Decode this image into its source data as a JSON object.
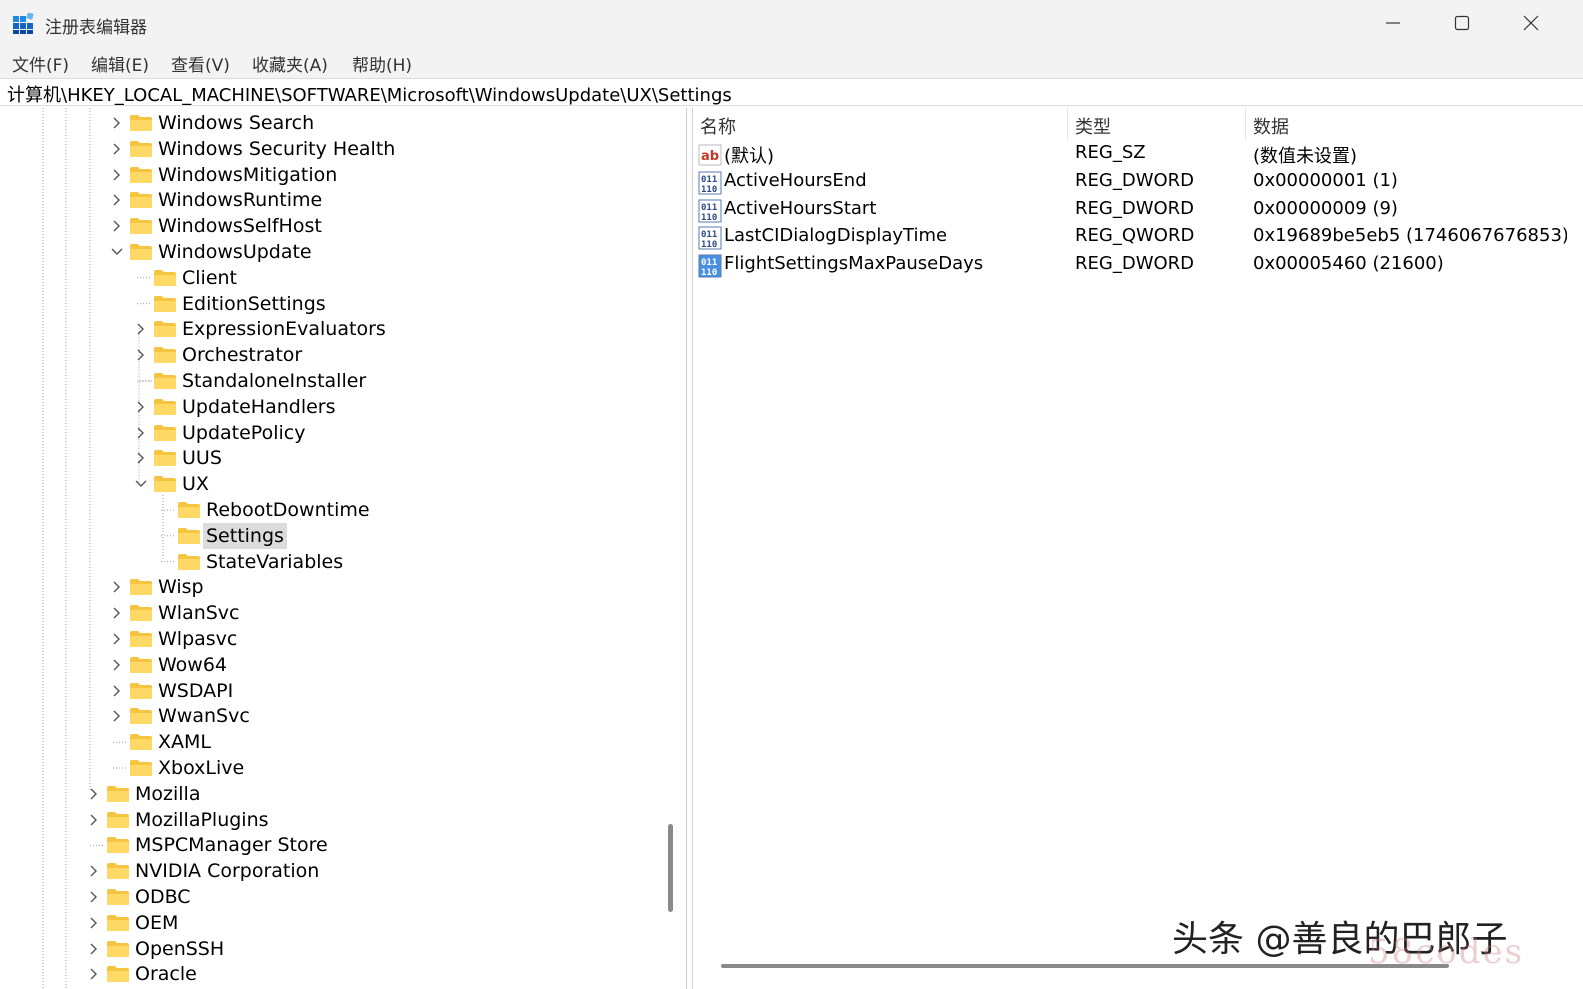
{
  "window": {
    "title": "注册表编辑器",
    "controls": {
      "minimize": "minimize",
      "maximize": "maximize",
      "close": "close"
    }
  },
  "menu": [
    "文件(F)",
    "编辑(E)",
    "查看(V)",
    "收藏夹(A)",
    "帮助(H)"
  ],
  "address": "计算机\\HKEY_LOCAL_MACHINE\\SOFTWARE\\Microsoft\\WindowsUpdate\\UX\\Settings",
  "tree": [
    {
      "label": "Windows Search",
      "expander": "collapsed",
      "level": 2
    },
    {
      "label": "Windows Security Health",
      "expander": "collapsed",
      "level": 2
    },
    {
      "label": "WindowsMitigation",
      "expander": "collapsed",
      "level": 2
    },
    {
      "label": "WindowsRuntime",
      "expander": "collapsed",
      "level": 2
    },
    {
      "label": "WindowsSelfHost",
      "expander": "collapsed",
      "level": 2
    },
    {
      "label": "WindowsUpdate",
      "expander": "expanded",
      "level": 2
    },
    {
      "label": "Client",
      "expander": "none",
      "level": 3
    },
    {
      "label": "EditionSettings",
      "expander": "none",
      "level": 3
    },
    {
      "label": "ExpressionEvaluators",
      "expander": "collapsed",
      "level": 3
    },
    {
      "label": "Orchestrator",
      "expander": "collapsed",
      "level": 3
    },
    {
      "label": "StandaloneInstaller",
      "expander": "none",
      "level": 3
    },
    {
      "label": "UpdateHandlers",
      "expander": "collapsed",
      "level": 3
    },
    {
      "label": "UpdatePolicy",
      "expander": "collapsed",
      "level": 3
    },
    {
      "label": "UUS",
      "expander": "collapsed",
      "level": 3
    },
    {
      "label": "UX",
      "expander": "expanded",
      "level": 3
    },
    {
      "label": "RebootDowntime",
      "expander": "none",
      "level": 4
    },
    {
      "label": "Settings",
      "expander": "none",
      "level": 4,
      "selected": true
    },
    {
      "label": "StateVariables",
      "expander": "none",
      "level": 4
    },
    {
      "label": "Wisp",
      "expander": "collapsed",
      "level": 2
    },
    {
      "label": "WlanSvc",
      "expander": "collapsed",
      "level": 2
    },
    {
      "label": "Wlpasvc",
      "expander": "collapsed",
      "level": 2
    },
    {
      "label": "Wow64",
      "expander": "collapsed",
      "level": 2
    },
    {
      "label": "WSDAPI",
      "expander": "collapsed",
      "level": 2
    },
    {
      "label": "WwanSvc",
      "expander": "collapsed",
      "level": 2
    },
    {
      "label": "XAML",
      "expander": "none",
      "level": 2
    },
    {
      "label": "XboxLive",
      "expander": "none",
      "level": 2
    },
    {
      "label": "Mozilla",
      "expander": "collapsed",
      "level": 1
    },
    {
      "label": "MozillaPlugins",
      "expander": "collapsed",
      "level": 1
    },
    {
      "label": "MSPCManager Store",
      "expander": "none",
      "level": 1
    },
    {
      "label": "NVIDIA Corporation",
      "expander": "collapsed",
      "level": 1
    },
    {
      "label": "ODBC",
      "expander": "collapsed",
      "level": 1
    },
    {
      "label": "OEM",
      "expander": "collapsed",
      "level": 1
    },
    {
      "label": "OpenSSH",
      "expander": "collapsed",
      "level": 1
    },
    {
      "label": "Oracle",
      "expander": "collapsed",
      "level": 1
    }
  ],
  "columns": {
    "name": "名称",
    "type": "类型",
    "data": "数据"
  },
  "values": [
    {
      "icon": "string-value-icon",
      "name": "(默认)",
      "type": "REG_SZ",
      "data": "(数值未设置)"
    },
    {
      "icon": "binary-value-icon",
      "name": "ActiveHoursEnd",
      "type": "REG_DWORD",
      "data": "0x00000001 (1)"
    },
    {
      "icon": "binary-value-icon",
      "name": "ActiveHoursStart",
      "type": "REG_DWORD",
      "data": "0x00000009 (9)"
    },
    {
      "icon": "binary-value-icon",
      "name": "LastCIDialogDisplayTime",
      "type": "REG_QWORD",
      "data": "0x19689be5eb5 (1746067676853)"
    },
    {
      "icon": "binary-value-icon",
      "name": "FlightSettingsMaxPauseDays",
      "type": "REG_DWORD",
      "data": "0x00005460 (21600)",
      "highlighted": true
    }
  ],
  "watermark": {
    "text": "头条 @善良的巴郎子",
    "overlay": "58codes"
  },
  "colors": {
    "folder": "#f5c542",
    "selection": "#dcdcdc",
    "chrome": "#f3f3f3"
  }
}
